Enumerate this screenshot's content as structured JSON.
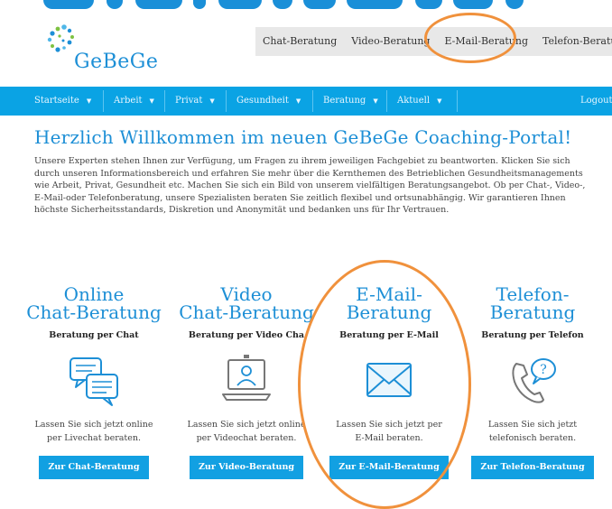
{
  "brand": {
    "logo_text": "GeBeGe",
    "logo_color": "#1d8fd6",
    "dot_colors": [
      "#1d8fd6",
      "#7ec242",
      "#4fb7e8"
    ]
  },
  "top_nav": {
    "items": [
      "Chat-Beratung",
      "Video-Beratung",
      "E-Mail-Beratung",
      "Telefon-Beratung"
    ]
  },
  "main_nav": {
    "items": [
      "Startseite",
      "Arbeit",
      "Privat",
      "Gesundheit",
      "Beratung",
      "Aktuell"
    ],
    "logout": "Logout",
    "bar_color": "#0aa3e4"
  },
  "page": {
    "title": "Herzlich Willkommen im neuen GeBeGe Coaching-Portal!",
    "intro": "Unsere Experten stehen Ihnen zur Verfügung, um Fragen zu ihrem jeweiligen Fachgebiet zu beantworten. Klicken Sie sich durch unseren Informationsbereich und erfahren Sie mehr über die Kernthemen des Betrieblichen Gesundheitsmanagements wie Arbeit, Privat, Gesundheit etc. Machen Sie sich ein Bild von unserem vielfältigen Beratungsangebot. Ob per Chat-, Video-, E-Mail-oder Telefonberatung, unsere Spezialisten beraten Sie zeitlich flexibel und ortsunabhängig. Wir garantieren Ihnen höchste Sicherheitsstandards, Diskretion und Anonymität und bedanken uns für Ihr Vertrauen."
  },
  "cards": [
    {
      "title_line1": "Online",
      "title_line2": "Chat-Beratung",
      "subtitle": "Beratung per Chat",
      "icon": "chat-bubbles-icon",
      "desc_line1": "Lassen Sie sich jetzt online",
      "desc_line2": "per Livechat beraten.",
      "button": "Zur Chat-Beratung"
    },
    {
      "title_line1": "Video",
      "title_line2": "Chat-Beratung",
      "subtitle": "Beratung per Video Cha",
      "icon": "video-laptop-icon",
      "desc_line1": "Lassen Sie sich jetzt online",
      "desc_line2": "per Videochat beraten.",
      "button": "Zur Video-Beratung"
    },
    {
      "title_line1": "E-Mail-",
      "title_line2": "Beratung",
      "subtitle": "Beratung per E-Mail",
      "icon": "envelope-icon",
      "desc_line1": "Lassen Sie sich jetzt per",
      "desc_line2": "E-Mail beraten.",
      "button": "Zur E-Mail-Beratung"
    },
    {
      "title_line1": "Telefon-",
      "title_line2": "Beratung",
      "subtitle": "Beratung per Telefon",
      "icon": "phone-question-icon",
      "desc_line1": "Lassen Sie sich jetzt",
      "desc_line2": "telefonisch beraten.",
      "button": "Zur Telefon-Beratung"
    }
  ],
  "colors": {
    "accent": "#1d8fd6",
    "button": "#12a0e2",
    "annotation": "#f0913c"
  }
}
